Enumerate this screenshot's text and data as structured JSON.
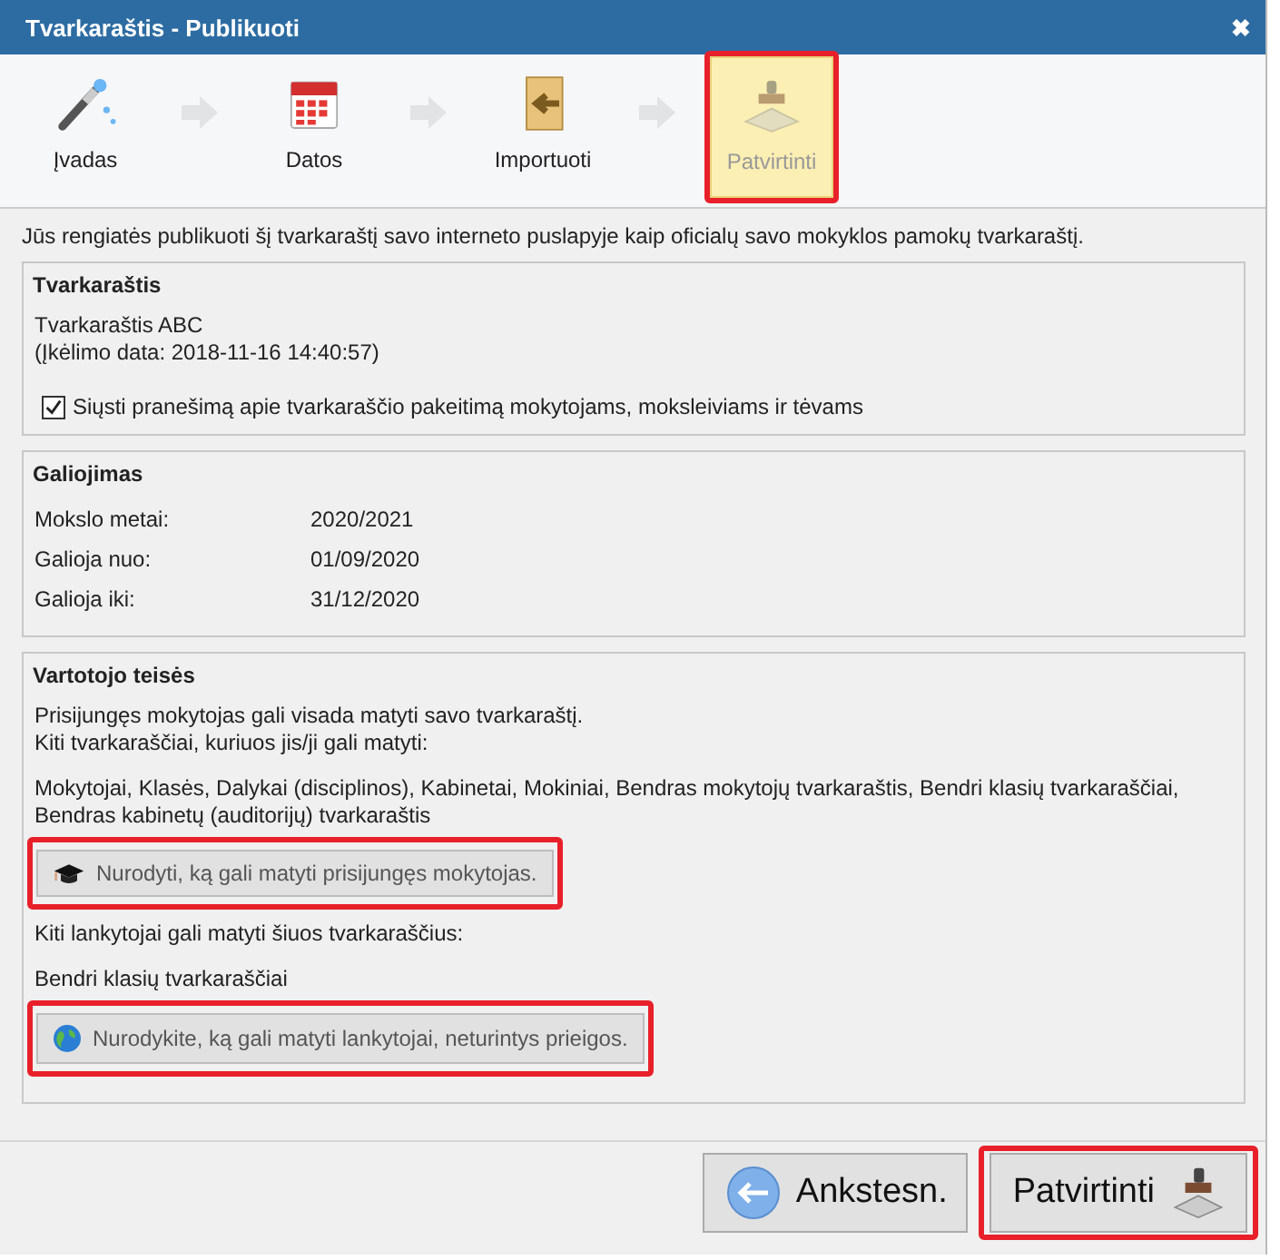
{
  "window": {
    "title": "Tvarkaraštis - Publikuoti",
    "close": "✖"
  },
  "steps": [
    {
      "label": "Įvadas",
      "kind": "wand",
      "selected": false,
      "highlighted": false
    },
    {
      "label": "Datos",
      "kind": "calendar",
      "selected": false,
      "highlighted": false
    },
    {
      "label": "Importuoti",
      "kind": "import",
      "selected": false,
      "highlighted": false
    },
    {
      "label": "Patvirtinti",
      "kind": "stamp",
      "selected": true,
      "highlighted": true
    }
  ],
  "intro": "Jūs rengiatės publikuoti šį tvarkaraštį savo interneto puslapyje kaip oficialų savo mokyklos pamokų tvarkaraštį.",
  "schedule": {
    "heading": "Tvarkaraštis",
    "name": "Tvarkaraštis ABC",
    "upload": "(Įkėlimo data: 2018-11-16 14:40:57)",
    "notify": {
      "label": "Siųsti pranešimą apie tvarkaraščio pakeitimą mokytojams, moksleiviams ir tėvams",
      "checked": true
    }
  },
  "validity": {
    "heading": "Galiojimas",
    "rows": [
      {
        "label": "Mokslo metai:",
        "value": "2020/2021"
      },
      {
        "label": "Galioja nuo:",
        "value": "01/09/2020"
      },
      {
        "label": "Galioja iki:",
        "value": "31/12/2020"
      }
    ]
  },
  "rights": {
    "heading": "Vartotojo teisės",
    "items": [
      {
        "kind": "text",
        "lines": [
          "Prisijungęs mokytojas gali visada matyti savo tvarkaraštį.",
          "Kiti tvarkaraščiai, kuriuos jis/ji gali matyti:"
        ]
      },
      {
        "kind": "text",
        "lines": [
          "Mokytojai, Klasės, Dalykai (disciplinos), Kabinetai, Mokiniai, Bendras mokytojų tvarkaraštis, Bendri klasių tvarkaraščiai, Bendras kabinetų (auditorijų) tvarkaraštis"
        ]
      },
      {
        "kind": "teacher_button",
        "label": "Nurodyti, ką gali matyti prisijungęs mokytojas.",
        "highlighted": true
      },
      {
        "kind": "text",
        "lines": [
          "Kiti lankytojai gali matyti šiuos tvarkaraščius:"
        ]
      },
      {
        "kind": "text",
        "lines": [
          "Bendri klasių tvarkaraščiai"
        ]
      },
      {
        "kind": "visitor_button",
        "label": "Nurodykite, ką gali matyti lankytojai, neturintys prieigos.",
        "highlighted": true
      }
    ]
  },
  "footer": [
    {
      "label": "Ankstesn.",
      "kind": "back",
      "highlighted": false
    },
    {
      "label": "Patvirtinti",
      "kind": "confirm",
      "highlighted": true
    }
  ]
}
